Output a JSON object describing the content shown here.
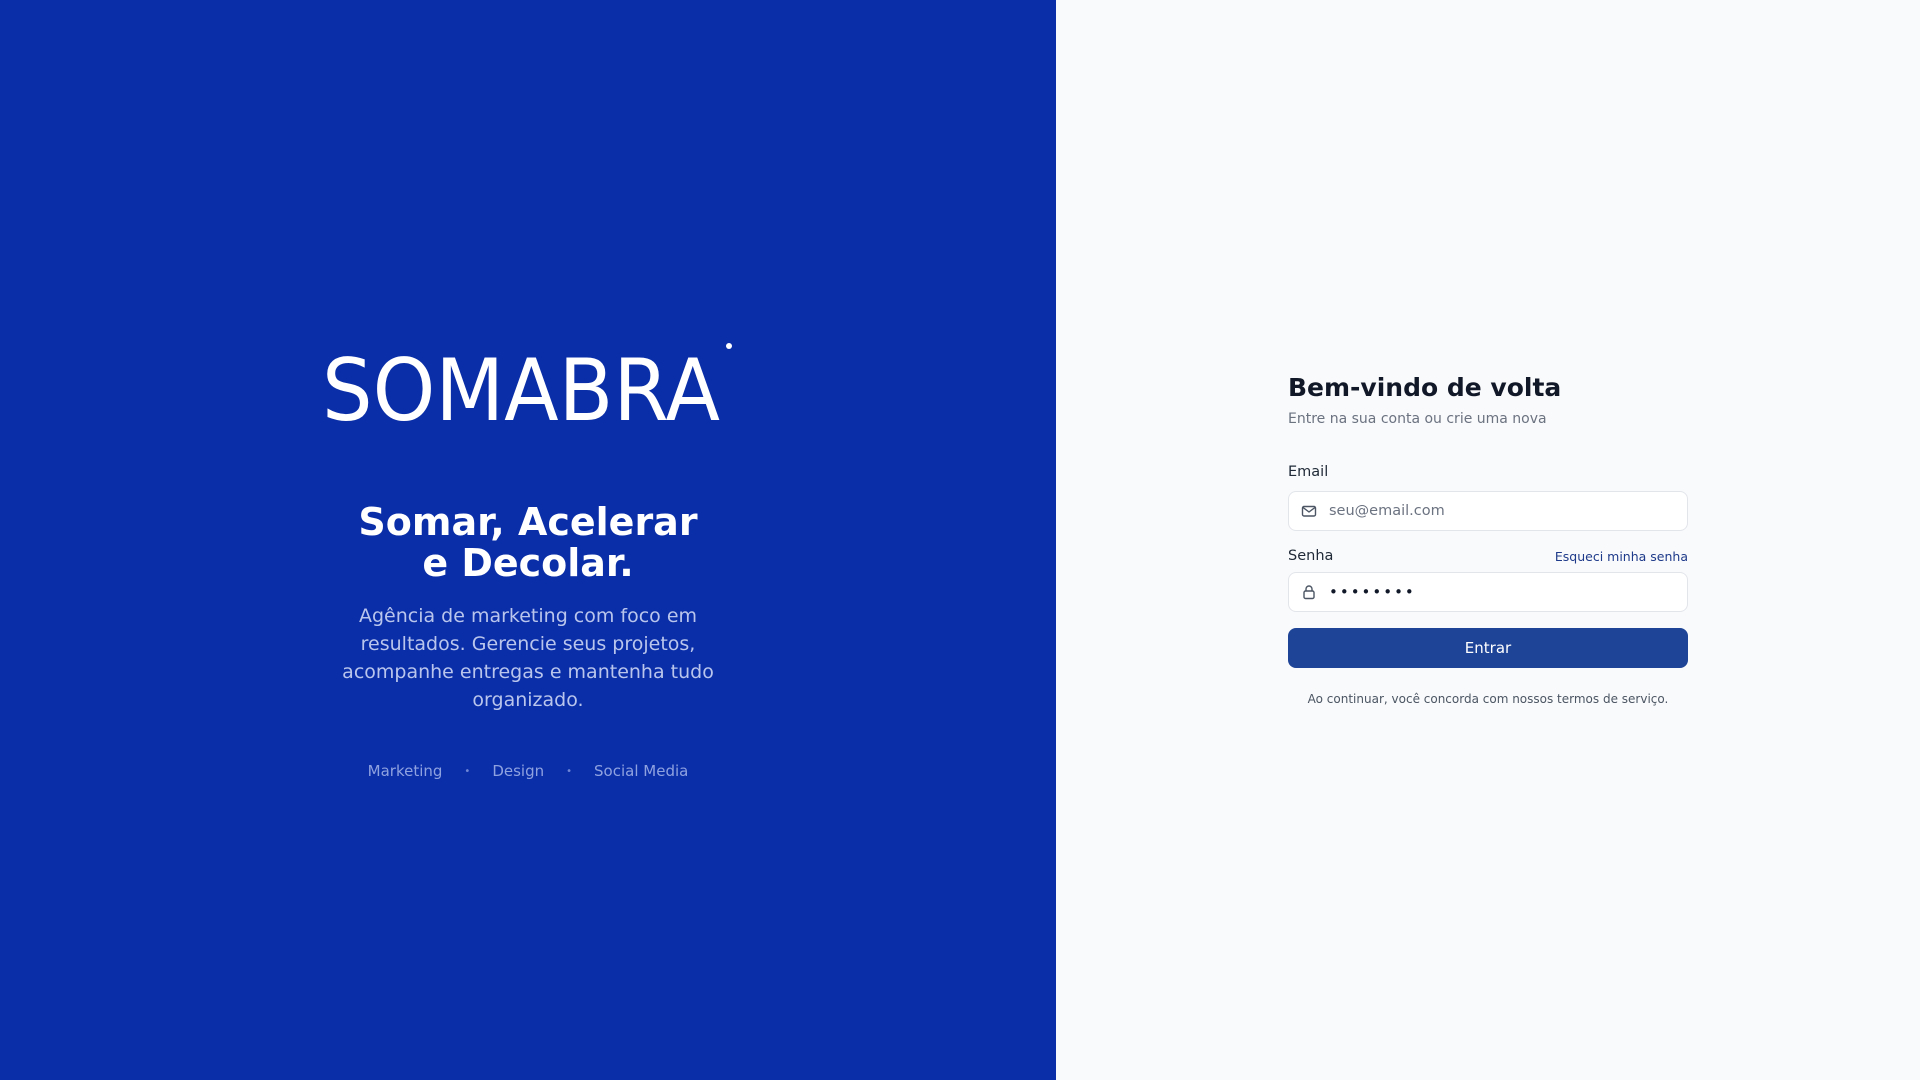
{
  "brand": {
    "logo_text": "SOMABRA",
    "tagline_line1": "Somar, Acelerar",
    "tagline_line2": "e Decolar.",
    "description": "Agência de marketing com foco em resultados. Gerencie seus projetos, acompanhe entregas e mantenha tudo organizado.",
    "features": [
      "Marketing",
      "Design",
      "Social Media"
    ],
    "separator": "•"
  },
  "form": {
    "title": "Bem-vindo de volta",
    "subtitle": "Entre na sua conta ou crie uma nova",
    "email_label": "Email",
    "email_placeholder": "seu@email.com",
    "email_value": "",
    "password_label": "Senha",
    "password_value": "12345678",
    "forgot_link": "Esqueci minha senha",
    "submit_label": "Entrar",
    "terms": "Ao continuar, você concorda com nossos termos de serviço."
  },
  "icons": {
    "email": "mail-icon",
    "password": "lock-icon"
  },
  "colors": {
    "brand_panel_bg": "#0a2ea8",
    "form_bg": "#f9fafb",
    "button_bg": "#1e4497",
    "link": "#1e3a8a"
  }
}
